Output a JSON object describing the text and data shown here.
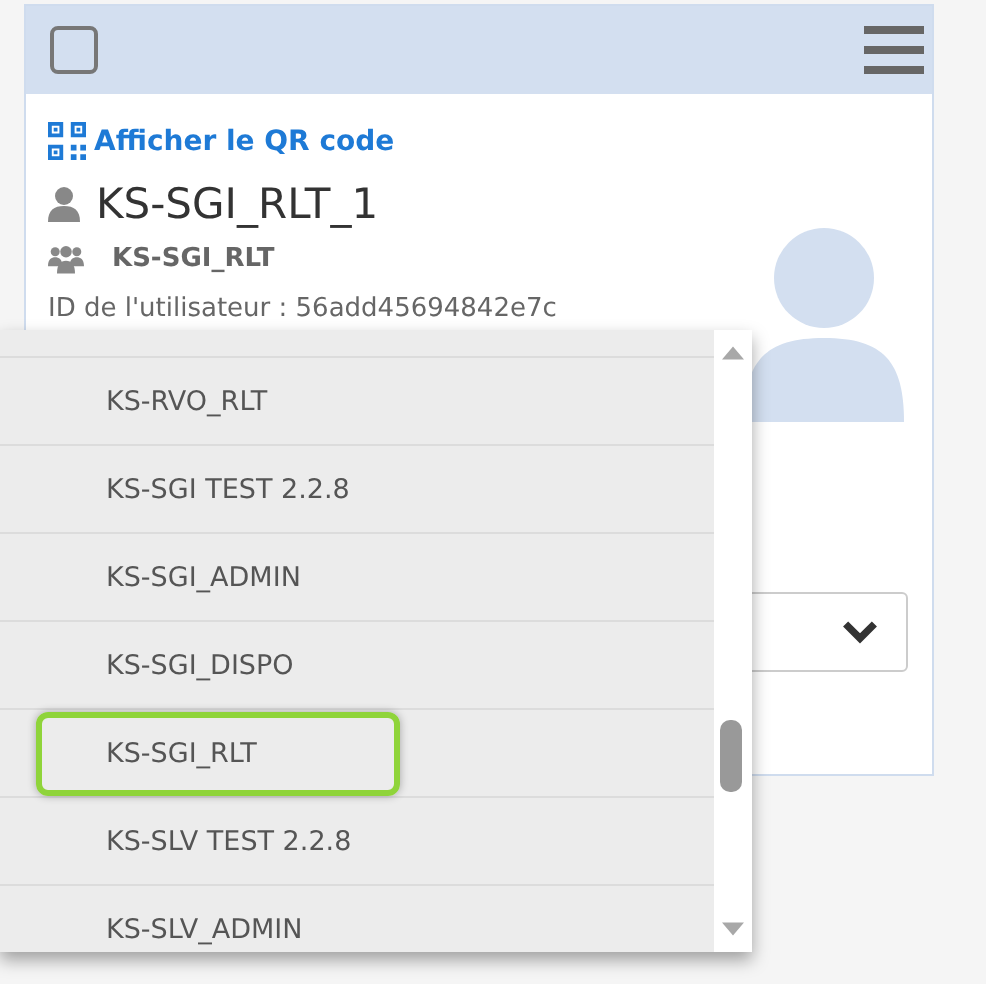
{
  "card": {
    "checked": false,
    "qr_link": "Afficher le QR code",
    "user_name": "KS-SGI_RLT_1",
    "group": "KS-SGI_RLT",
    "user_id": "ID de l'utilisateur : 56add45694842e7c"
  },
  "dropdown": {
    "items": [
      {
        "label": "KS-RVO_RLT",
        "selected": false
      },
      {
        "label": "KS-SGI TEST 2.2.8",
        "selected": false
      },
      {
        "label": "KS-SGI_ADMIN",
        "selected": false
      },
      {
        "label": "KS-SGI_DISPO",
        "selected": false
      },
      {
        "label": "KS-SGI_RLT",
        "selected": true
      },
      {
        "label": "KS-SLV TEST 2.2.8",
        "selected": false
      },
      {
        "label": "KS-SLV_ADMIN",
        "selected": false
      }
    ]
  }
}
